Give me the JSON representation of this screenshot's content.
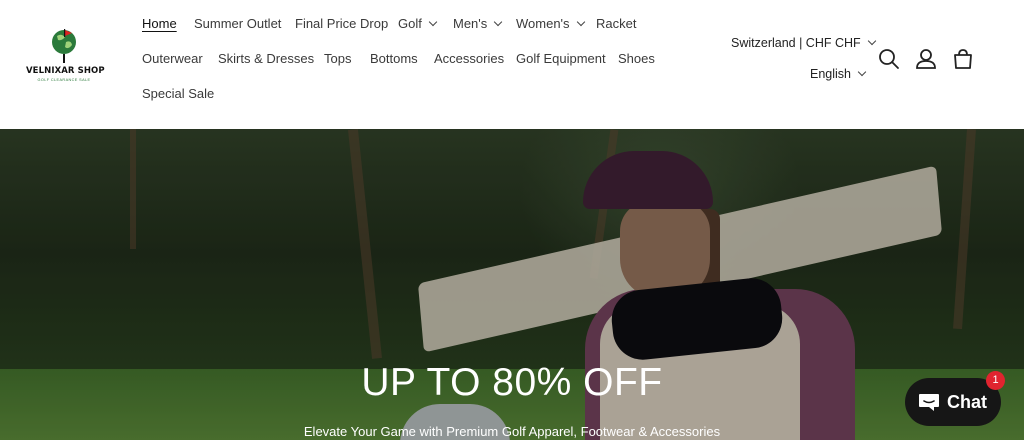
{
  "logo": {
    "name": "VELNIXAR SHOP",
    "tagline": "GOLF CLEARANCE SALE"
  },
  "nav": {
    "row1": [
      {
        "label": "Home",
        "active": true
      },
      {
        "label": "Summer Outlet"
      },
      {
        "label": "Final Price Drop"
      },
      {
        "label": "Golf",
        "dropdown": true
      },
      {
        "label": "Men's",
        "dropdown": true
      },
      {
        "label": "Women's",
        "dropdown": true
      },
      {
        "label": "Racket"
      }
    ],
    "row2": [
      {
        "label": "Outerwear"
      },
      {
        "label": "Skirts & Dresses"
      },
      {
        "label": "Tops"
      },
      {
        "label": "Bottoms"
      },
      {
        "label": "Accessories"
      },
      {
        "label": "Golf Equipment"
      },
      {
        "label": "Shoes"
      }
    ],
    "row3": [
      {
        "label": "Special Sale"
      }
    ]
  },
  "locale": {
    "country": "Switzerland | CHF CHF",
    "language": "English"
  },
  "icons": {
    "search": "search-icon",
    "account": "account-icon",
    "cart": "cart-icon"
  },
  "hero": {
    "title": "UP TO 80% OFF",
    "subtitle": "Elevate Your Game with Premium Golf Apparel, Footwear & Accessories"
  },
  "chat": {
    "label": "Chat",
    "badge": "1"
  },
  "colors": {
    "chat_bg": "#161616",
    "badge": "#e0242f",
    "logo_green": "#2b7a3b"
  }
}
